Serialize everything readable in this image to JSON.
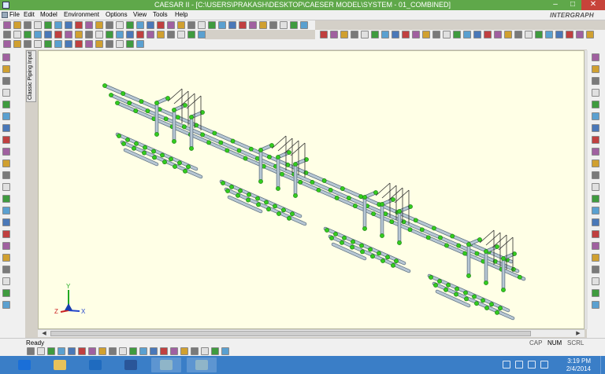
{
  "window": {
    "title": "CAESAR II - [C:\\USERS\\PRAKASH\\DESKTOP\\CAESER MODEL\\SYSTEM - 01_COMBINED]",
    "controls": [
      "–",
      "□",
      "✕"
    ],
    "brand": "INTERGRAPH"
  },
  "menu": {
    "items": [
      "File",
      "Edit",
      "Model",
      "Environment",
      "Options",
      "View",
      "Tools",
      "Help"
    ]
  },
  "side_tab": {
    "label": "Classic Piping Input"
  },
  "model": {
    "units": 4,
    "supports_per_unit": 4,
    "pipe_color": "#b7c7d4",
    "pipe_outline": "#5c6f80",
    "fitting_color": "#33cc1f",
    "support_color": "#2f2f2f"
  },
  "triad": {
    "y_label": "Y",
    "x_label": "X",
    "z_label": "Z",
    "y_color": "#22aa22",
    "x_color": "#2244cc",
    "z_color": "#cc2222"
  },
  "status": {
    "text": "Ready",
    "indicators": [
      "CAP",
      "NUM",
      "SCRL"
    ]
  },
  "taskbar": {
    "apps": [
      {
        "name": "ie",
        "color": "#1a6fd8"
      },
      {
        "name": "explorer",
        "color": "#e8c25a"
      },
      {
        "name": "outlook",
        "color": "#1f6bbf"
      },
      {
        "name": "word",
        "color": "#2a5699"
      },
      {
        "name": "caesar-1",
        "color": "#8fb5c8"
      },
      {
        "name": "caesar-2",
        "color": "#8fb5c8"
      }
    ],
    "clock_time": "3:19 PM",
    "clock_date": "2/4/2014"
  },
  "colors": {
    "titlebar": "#5fa84a",
    "taskbar": "#3a7ec7",
    "viewport": "#ffffe6"
  }
}
